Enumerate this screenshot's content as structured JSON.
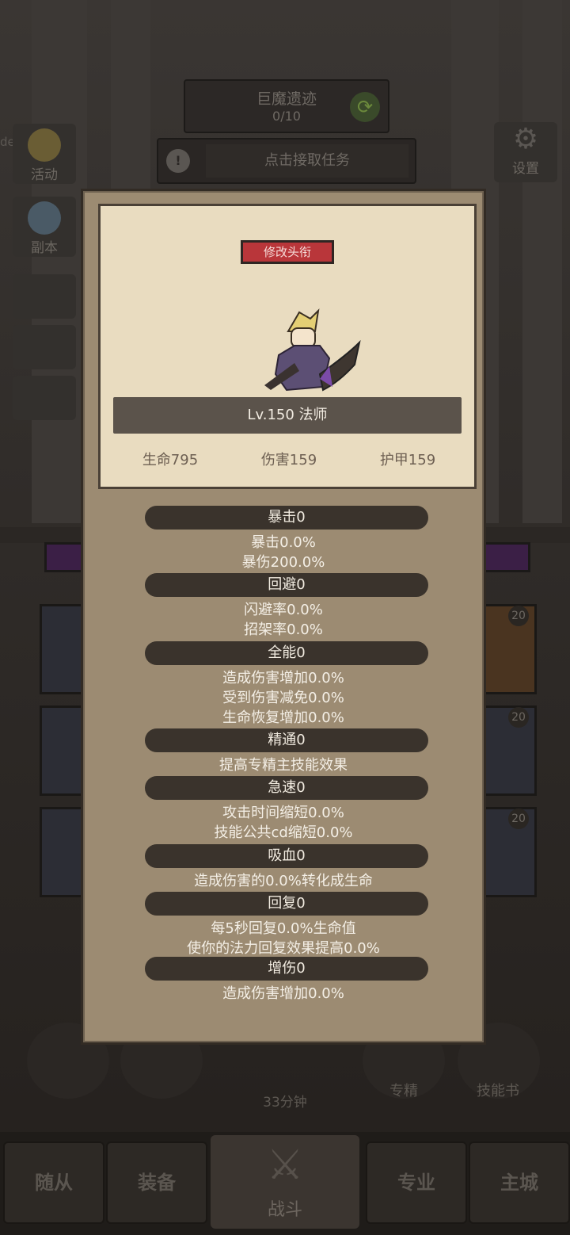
{
  "background": {
    "dungeon": {
      "title": "巨魔遗迹",
      "progress": "0/10"
    },
    "task_label": "点击接取任务",
    "username": "de****bao",
    "left_buttons": [
      {
        "label": "活动",
        "icon": "star-trophy-icon"
      },
      {
        "label": "副本",
        "icon": "portal-icon"
      }
    ],
    "settings_label": "设置",
    "slot_level": "20",
    "timer": "33分钟",
    "side_labels": {
      "specialty": "专精",
      "skill_book": "技能书"
    },
    "nav": [
      "随从",
      "装备",
      "战斗",
      "专业",
      "主城"
    ]
  },
  "modal": {
    "change_title_button": "修改头衔",
    "level_class": "Lv.150 法师",
    "stats": {
      "life": "生命795",
      "damage": "伤害159",
      "armor": "护甲159"
    },
    "sections": [
      {
        "header": "暴击0",
        "lines": [
          "暴击0.0%",
          "暴伤200.0%"
        ]
      },
      {
        "header": "回避0",
        "lines": [
          "闪避率0.0%",
          "招架率0.0%"
        ]
      },
      {
        "header": "全能0",
        "lines": [
          "造成伤害增加0.0%",
          "受到伤害减免0.0%",
          "生命恢复增加0.0%"
        ]
      },
      {
        "header": "精通0",
        "lines": [
          "提高专精主技能效果"
        ]
      },
      {
        "header": "急速0",
        "lines": [
          "攻击时间缩短0.0%",
          "技能公共cd缩短0.0%"
        ]
      },
      {
        "header": "吸血0",
        "lines": [
          "造成伤害的0.0%转化成生命"
        ]
      },
      {
        "header": "回复0",
        "lines": [
          "每5秒回复0.0%生命值",
          "使你的法力回复效果提高0.0%"
        ]
      },
      {
        "header": "增伤0",
        "lines": [
          "造成伤害增加0.0%"
        ]
      }
    ]
  },
  "colors": {
    "title_button": "#b9363a",
    "panel": "#9c8b72",
    "card": "#e9dcc0",
    "pill": "#3a332c"
  }
}
